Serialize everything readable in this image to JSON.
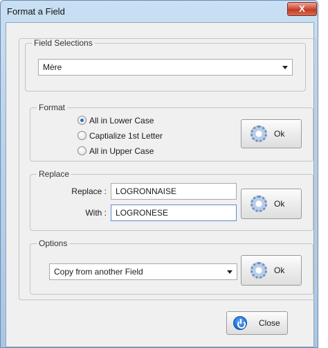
{
  "window": {
    "title": "Format a Field",
    "close_glyph": "X"
  },
  "field_selections": {
    "legend": "Field Selections",
    "selected": "Mère"
  },
  "format": {
    "legend": "Format",
    "options": [
      {
        "label": "All in Lower Case",
        "selected": true
      },
      {
        "label": "Captialize 1st Letter",
        "selected": false
      },
      {
        "label": "All in Upper Case",
        "selected": false
      }
    ],
    "ok_label": "Ok"
  },
  "replace": {
    "legend": "Replace",
    "replace_label": "Replace :",
    "replace_value": "LOGRONNAISE",
    "with_label": "With :",
    "with_value": "LOGRONESE",
    "ok_label": "Ok"
  },
  "options": {
    "legend": "Options",
    "selected": "Copy from another Field",
    "ok_label": "Ok"
  },
  "footer": {
    "close_label": "Close"
  },
  "icons": {
    "ok": "gear-icon",
    "close": "power-icon"
  }
}
